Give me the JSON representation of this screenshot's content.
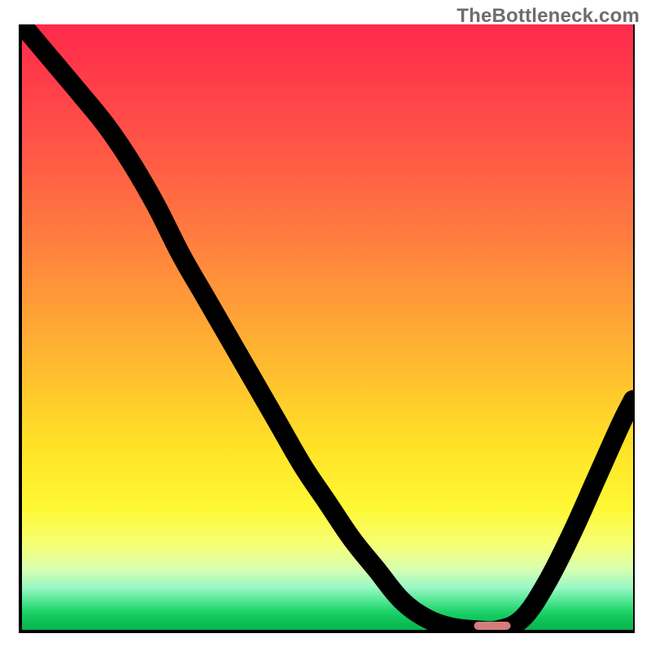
{
  "watermark": "TheBottleneck.com",
  "colors": {
    "axis": "#000000",
    "marker": "#d57d7d",
    "gradient_top": "#ff2a4b",
    "gradient_bottom": "#0ab64d"
  },
  "chart_data": {
    "type": "line",
    "title": "",
    "xlabel": "",
    "ylabel": "",
    "xlim": [
      0,
      100
    ],
    "ylim": [
      0,
      100
    ],
    "grid": false,
    "legend": false,
    "x": [
      0,
      5,
      10,
      14,
      18,
      22,
      26,
      30,
      34,
      38,
      42,
      46,
      50,
      54,
      58,
      62,
      66,
      70,
      74,
      78,
      82,
      86,
      90,
      94,
      98,
      100
    ],
    "values": [
      100,
      94,
      88,
      83,
      77,
      70,
      62,
      55,
      48,
      41,
      34,
      27,
      21,
      15,
      10,
      5,
      2,
      0.5,
      0,
      0,
      2,
      8,
      16,
      25,
      34,
      38
    ],
    "marker": {
      "x_start": 74,
      "x_end": 80,
      "y": 0,
      "label": ""
    },
    "annotations": []
  }
}
